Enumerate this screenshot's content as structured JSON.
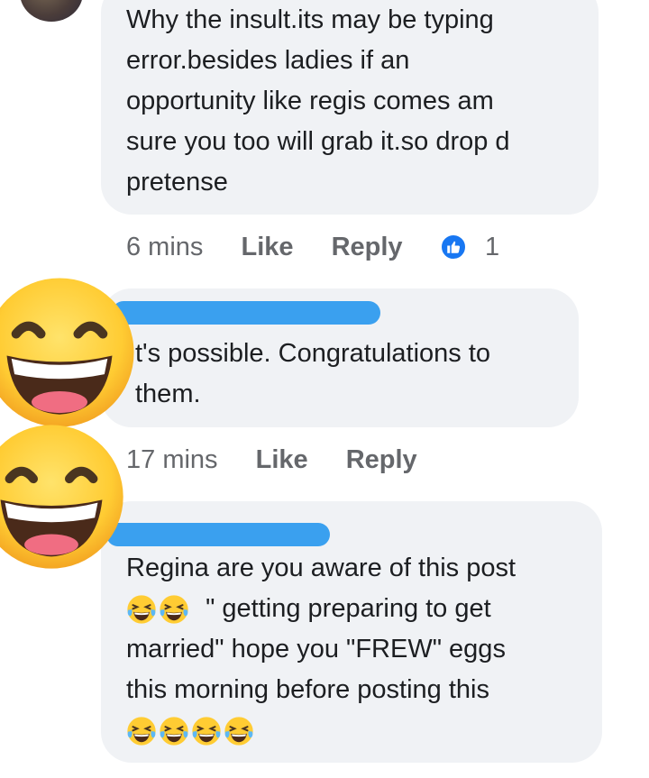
{
  "comments": [
    {
      "lines": [
        "Why the insult.its may be typing",
        "error.besides ladies if an",
        "opportunity like regis comes am",
        "sure you too will grab it.so drop d",
        "pretense"
      ],
      "time": "6 mins",
      "like_label": "Like",
      "reply_label": "Reply",
      "reaction_count": "1"
    },
    {
      "lines": [
        "t's possible. Congratulations to",
        "them."
      ],
      "time": "17 mins",
      "like_label": "Like",
      "reply_label": "Reply"
    },
    {
      "lines": [
        "Regina are you aware of this post",
        "\" getting preparing to get",
        "married\" hope you \"FREW\" eggs",
        "this morning before posting this"
      ]
    }
  ],
  "icons": {
    "reaction": "thumbs-up-icon",
    "big_emoji": "grinning-face-emoji",
    "small_emoji": "laughing-tears-emoji"
  },
  "colors": {
    "bubble": "#f0f2f5",
    "meta_text": "#65676b",
    "like_blue": "#1877f2",
    "redaction": "#3aa0ef"
  }
}
